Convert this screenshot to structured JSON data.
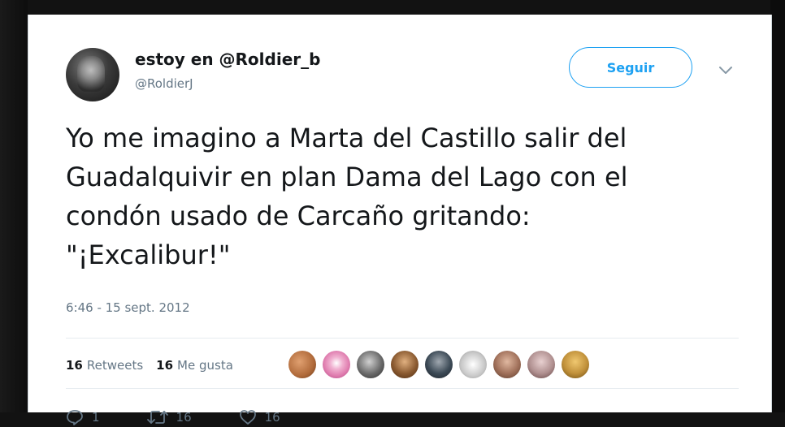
{
  "tweet": {
    "display_name": "estoy en @Roldier_b",
    "handle": "@RoldierJ",
    "follow_label": "Seguir",
    "text_lines": [
      "Yo me imagino a Marta del Castillo salir del",
      "Guadalquivir en plan Dama del Lago con el",
      "condón usado de Carcaño gritando:",
      "\"¡Excalibur!\""
    ],
    "timestamp": "6:46 - 15 sept. 2012",
    "stats": {
      "retweets_count": "16",
      "retweets_label": "Retweets",
      "likes_count": "16",
      "likes_label": "Me gusta"
    },
    "actions": {
      "reply_count": "1",
      "retweet_count": "16",
      "like_count": "16"
    }
  },
  "icons": [
    "chevron-down-icon",
    "reply-icon",
    "retweet-icon",
    "like-icon"
  ],
  "colors": {
    "accent": "#1da1f2",
    "text": "#14171a",
    "secondary": "#657786",
    "likers": [
      "#b06a3a",
      "#e07fb0",
      "#6a6a6a",
      "#8a5a30",
      "#3c4a56",
      "#c8c8c8",
      "#a0705a",
      "#b09090",
      "#c0903a"
    ]
  }
}
